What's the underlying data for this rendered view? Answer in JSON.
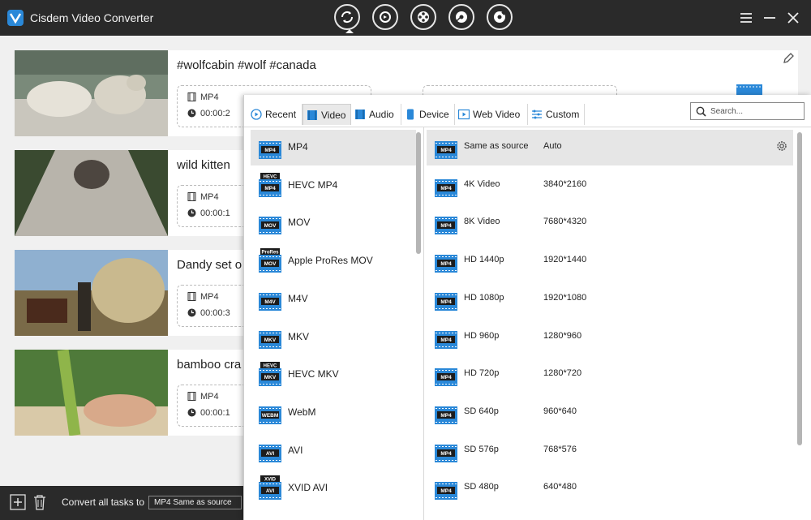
{
  "app": {
    "title": "Cisdem Video Converter"
  },
  "colors": {
    "titlebar": "#2a2a2a",
    "accent": "#2a88d8",
    "selected_row": "#e6e6e6"
  },
  "modes": [
    {
      "name": "convert-mode",
      "icon": "convert-icon"
    },
    {
      "name": "compress-mode",
      "icon": "compress-icon"
    },
    {
      "name": "download-mode",
      "icon": "download-icon"
    },
    {
      "name": "rip-mode",
      "icon": "rip-icon"
    },
    {
      "name": "burn-mode",
      "icon": "burn-icon"
    }
  ],
  "tasks": [
    {
      "title": "#wolfcabin #wolf #canada",
      "format": "MP4",
      "duration": "00:00:2"
    },
    {
      "title": "wild kitten",
      "format": "MP4",
      "duration": "00:00:1"
    },
    {
      "title": "Dandy set o",
      "format": "MP4",
      "duration": "00:00:3"
    },
    {
      "title": "bamboo cra",
      "format": "MP4",
      "duration": "00:00:1"
    }
  ],
  "bottom": {
    "convert_label": "Convert all tasks to",
    "convert_value": "MP4 Same as source"
  },
  "popup": {
    "tabs": [
      {
        "label": "Recent",
        "icon": "recent-icon"
      },
      {
        "label": "Video",
        "icon": "video-film-icon"
      },
      {
        "label": "Audio",
        "icon": "audio-icon"
      },
      {
        "label": "Device",
        "icon": "device-icon"
      },
      {
        "label": "Web Video",
        "icon": "web-video-icon"
      },
      {
        "label": "Custom",
        "icon": "custom-icon"
      }
    ],
    "search_placeholder": "Search...",
    "formats": [
      {
        "label": "MP4",
        "badge": "MP4",
        "top": ""
      },
      {
        "label": "HEVC MP4",
        "badge": "MP4",
        "top": "HEVC"
      },
      {
        "label": "MOV",
        "badge": "MOV",
        "top": ""
      },
      {
        "label": "Apple ProRes MOV",
        "badge": "MOV",
        "top": "ProRes"
      },
      {
        "label": "M4V",
        "badge": "M4V",
        "top": ""
      },
      {
        "label": "MKV",
        "badge": "MKV",
        "top": ""
      },
      {
        "label": "HEVC MKV",
        "badge": "MKV",
        "top": "HEVC"
      },
      {
        "label": "WebM",
        "badge": "WEBM",
        "top": ""
      },
      {
        "label": "AVI",
        "badge": "AVI",
        "top": ""
      },
      {
        "label": "XVID AVI",
        "badge": "AVI",
        "top": "XVID"
      }
    ],
    "resolutions": [
      {
        "name": "Same as source",
        "size": "Auto"
      },
      {
        "name": "4K Video",
        "size": "3840*2160"
      },
      {
        "name": "8K Video",
        "size": "7680*4320"
      },
      {
        "name": "HD 1440p",
        "size": "1920*1440"
      },
      {
        "name": "HD 1080p",
        "size": "1920*1080"
      },
      {
        "name": "HD 960p",
        "size": "1280*960"
      },
      {
        "name": "HD 720p",
        "size": "1280*720"
      },
      {
        "name": "SD 640p",
        "size": "960*640"
      },
      {
        "name": "SD 576p",
        "size": "768*576"
      },
      {
        "name": "SD 480p",
        "size": "640*480"
      }
    ]
  }
}
